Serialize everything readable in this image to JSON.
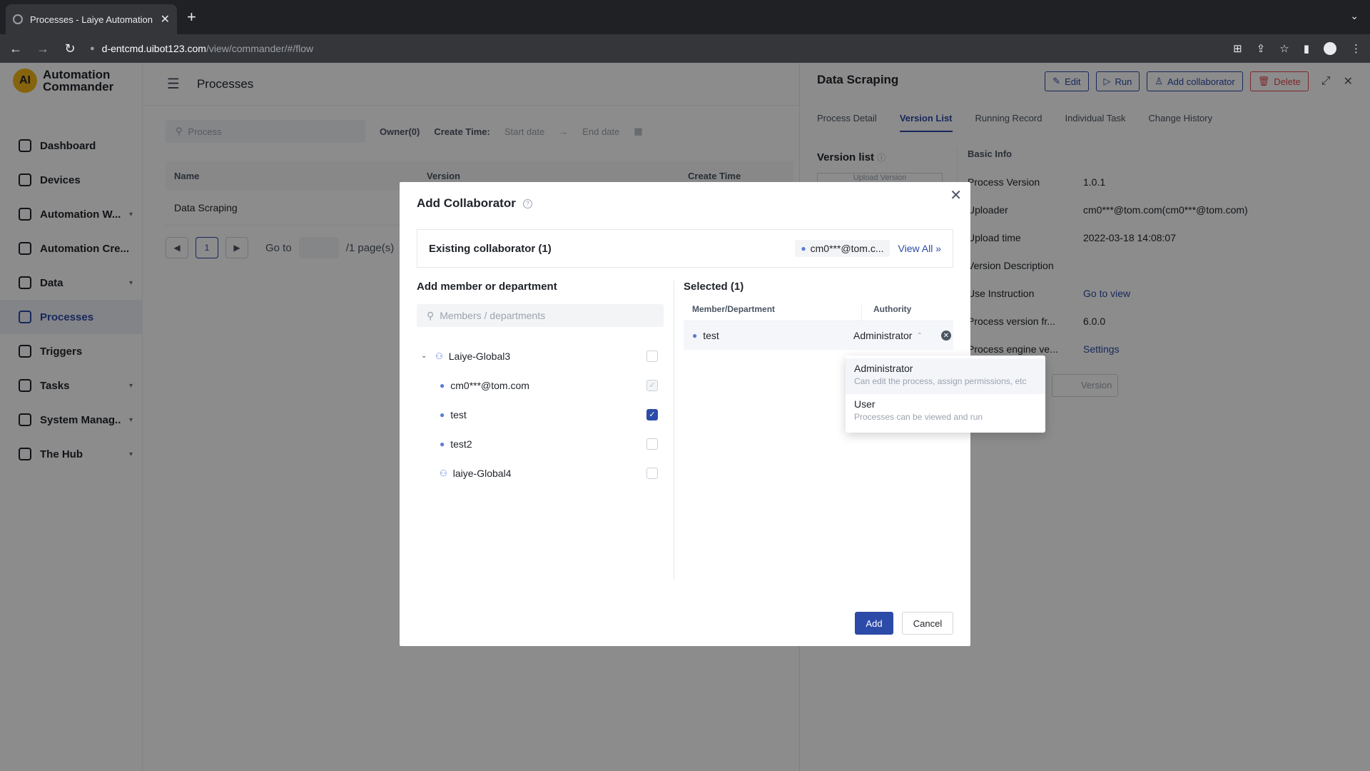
{
  "browser": {
    "tab_title": "Processes - Laiye Automation C",
    "url_host": "d-entcmd.uibot123.com",
    "url_path": "/view/commander/#/flow"
  },
  "app": {
    "logo_line1": "Automation",
    "logo_line2": "Commander",
    "logo_mark": "AI",
    "sidebar": [
      {
        "label": "Dashboard",
        "icon": "dashboard-icon",
        "caret": false,
        "active": false
      },
      {
        "label": "Devices",
        "icon": "devices-icon",
        "caret": false,
        "active": false
      },
      {
        "label": "Automation W...",
        "icon": "automation-workers-icon",
        "caret": true,
        "active": false
      },
      {
        "label": "Automation Cre...",
        "icon": "automation-creators-icon",
        "caret": false,
        "active": false
      },
      {
        "label": "Data",
        "icon": "data-icon",
        "caret": true,
        "active": false
      },
      {
        "label": "Processes",
        "icon": "processes-icon",
        "caret": false,
        "active": true
      },
      {
        "label": "Triggers",
        "icon": "triggers-icon",
        "caret": false,
        "active": false
      },
      {
        "label": "Tasks",
        "icon": "tasks-icon",
        "caret": true,
        "active": false
      },
      {
        "label": "System Manag...",
        "icon": "system-management-icon",
        "caret": true,
        "active": false
      },
      {
        "label": "The Hub",
        "icon": "hub-icon",
        "caret": true,
        "active": false
      }
    ],
    "main": {
      "title": "Processes",
      "search_placeholder": "Process",
      "owner_filter": "Owner(0)",
      "create_time_label": "Create Time:",
      "start_date": "Start date",
      "end_date": "End date",
      "columns": [
        "Name",
        "Version",
        "Create Time"
      ],
      "rows": [
        {
          "name": "Data Scraping"
        }
      ],
      "page_current": "1",
      "goto_label": "Go to",
      "pages_label": "/1 page(s)"
    },
    "drawer": {
      "title": "Data Scraping",
      "actions": {
        "edit": "Edit",
        "run": "Run",
        "add_collaborator": "Add collaborator",
        "delete": "Delete"
      },
      "tabs": [
        "Process Detail",
        "Version List",
        "Running Record",
        "Individual Task",
        "Change History"
      ],
      "active_tab": "Version List",
      "version_list_label": "Version list",
      "upload_version": "Upload Version",
      "basic_info": "Basic Info",
      "info": [
        {
          "label": "Process Version",
          "value": "1.0.1"
        },
        {
          "label": "Uploader",
          "value": "cm0***@tom.com(cm0***@tom.com)"
        },
        {
          "label": "Upload time",
          "value": "2022-03-18 14:08:07"
        },
        {
          "label": "Version Description",
          "value": ""
        },
        {
          "label": "Use Instruction",
          "value": "Go to view"
        },
        {
          "label": "Process version fr...",
          "value": "6.0.0"
        },
        {
          "label": "Process engine ve...",
          "value": "Settings"
        }
      ],
      "hidden_btn": "Version"
    }
  },
  "modal": {
    "title": "Add Collaborator",
    "existing_label": "Existing collaborator (1)",
    "existing_chip": "cm0***@tom.c...",
    "view_all": "View All",
    "add_member_title": "Add member or department",
    "member_search_placeholder": "Members / departments",
    "tree": [
      {
        "label": "Laiye-Global3",
        "type": "department",
        "level": 0,
        "expanded": true,
        "state": "unchecked"
      },
      {
        "label": "cm0***@tom.com",
        "type": "member",
        "level": 1,
        "state": "disabled-checked"
      },
      {
        "label": "test",
        "type": "member",
        "level": 1,
        "state": "checked"
      },
      {
        "label": "test2",
        "type": "member",
        "level": 1,
        "state": "unchecked"
      },
      {
        "label": "laiye-Global4",
        "type": "department",
        "level": 1,
        "state": "unchecked"
      }
    ],
    "selected_title": "Selected (1)",
    "selected_columns": [
      "Member/Department",
      "Authority"
    ],
    "selected_rows": [
      {
        "name": "test",
        "authority": "Administrator"
      }
    ],
    "authority_options": [
      {
        "title": "Administrator",
        "desc": "Can edit the process, assign permissions, etc"
      },
      {
        "title": "User",
        "desc": "Processes can be viewed and run"
      }
    ],
    "add_button": "Add",
    "cancel_button": "Cancel"
  },
  "colors": {
    "primary": "#2c4aa8",
    "danger": "#e5484d",
    "overlay": "rgba(0,0,0,0.45)"
  }
}
